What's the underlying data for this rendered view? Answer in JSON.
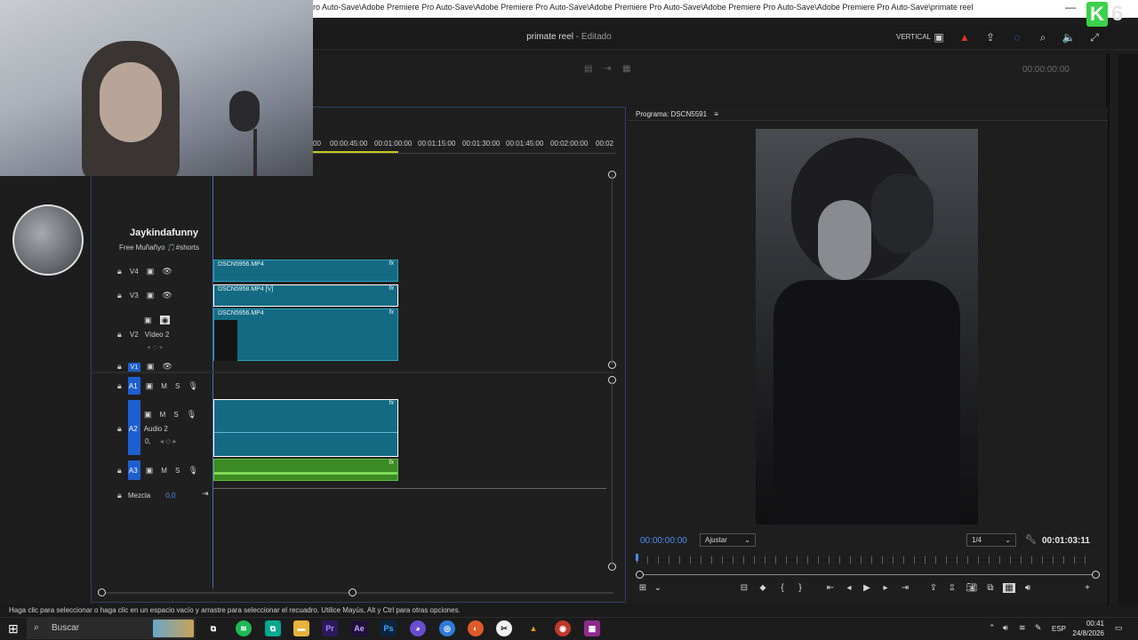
{
  "window": {
    "title_path": "ro Auto-Save\\Adobe Premiere Pro Auto-Save\\Adobe Premiere Pro Auto-Save\\Adobe Premiere Pro Auto-Save\\Adobe Premiere Pro Auto-Save\\Adobe Premiere Pro Auto-Save\\primate reel",
    "project_name": "primate reel",
    "project_state": "- Editado",
    "layout_label": "VERTICAL",
    "minimize_glyph": "—"
  },
  "overlay": {
    "badge_letter": "K",
    "badge_number": "6",
    "channel_name": "Jaykindafunny",
    "channel_subtitle": "Free Muñañyo 🎵#shorts"
  },
  "source_monitor": {
    "timecode": "00:00:00:00"
  },
  "timeline": {
    "ruler_labels": [
      "00",
      "00:00:45:00",
      "00:01:00:00",
      "00:01:15:00",
      "00:01:30:00",
      "00:01:45:00",
      "00:02:00:00",
      "00:02"
    ],
    "tracks": {
      "v4": "V4",
      "v3": "V3",
      "v2": "V2",
      "v2_name": "Vídeo 2",
      "v1": "V1",
      "a1": "A1",
      "a2": "A2",
      "a2_name": "Audio 2",
      "a3": "A3",
      "mix_label": "Mezcla",
      "mix_value": "0,0",
      "a2_volume": "0,",
      "m_label": "M",
      "s_label": "S"
    },
    "clips": {
      "v4_clip": "DSCN5956.MP4",
      "v3_clip": "DSCN5958.MP4 [V]",
      "v2_clip": "DSCN5956.MP4",
      "fx_label": "fx"
    }
  },
  "program_monitor": {
    "title": "Programa: DSCN5591",
    "timecode": "00:00:00:00",
    "fit_option": "Ajustar",
    "resolution": "1/4",
    "duration": "00:01:03:11"
  },
  "status": {
    "text": "Haga clic para seleccionar o haga clic en un espacio vacío y arrastre para seleccionar el recuadro. Utilice Mayús, Alt y Ctrl para otras opciones."
  },
  "taskbar": {
    "search_placeholder": "Buscar",
    "apps": [
      "Pr",
      "Ae",
      "Ps"
    ],
    "language": "ESP",
    "time": "00:41",
    "date": "24/8/2026"
  },
  "colors": {
    "clip_video": "#146a82",
    "clip_audio_green": "#3b8a23",
    "timecode_blue": "#4a8ff0",
    "track_badge": "#1e5fd0"
  }
}
